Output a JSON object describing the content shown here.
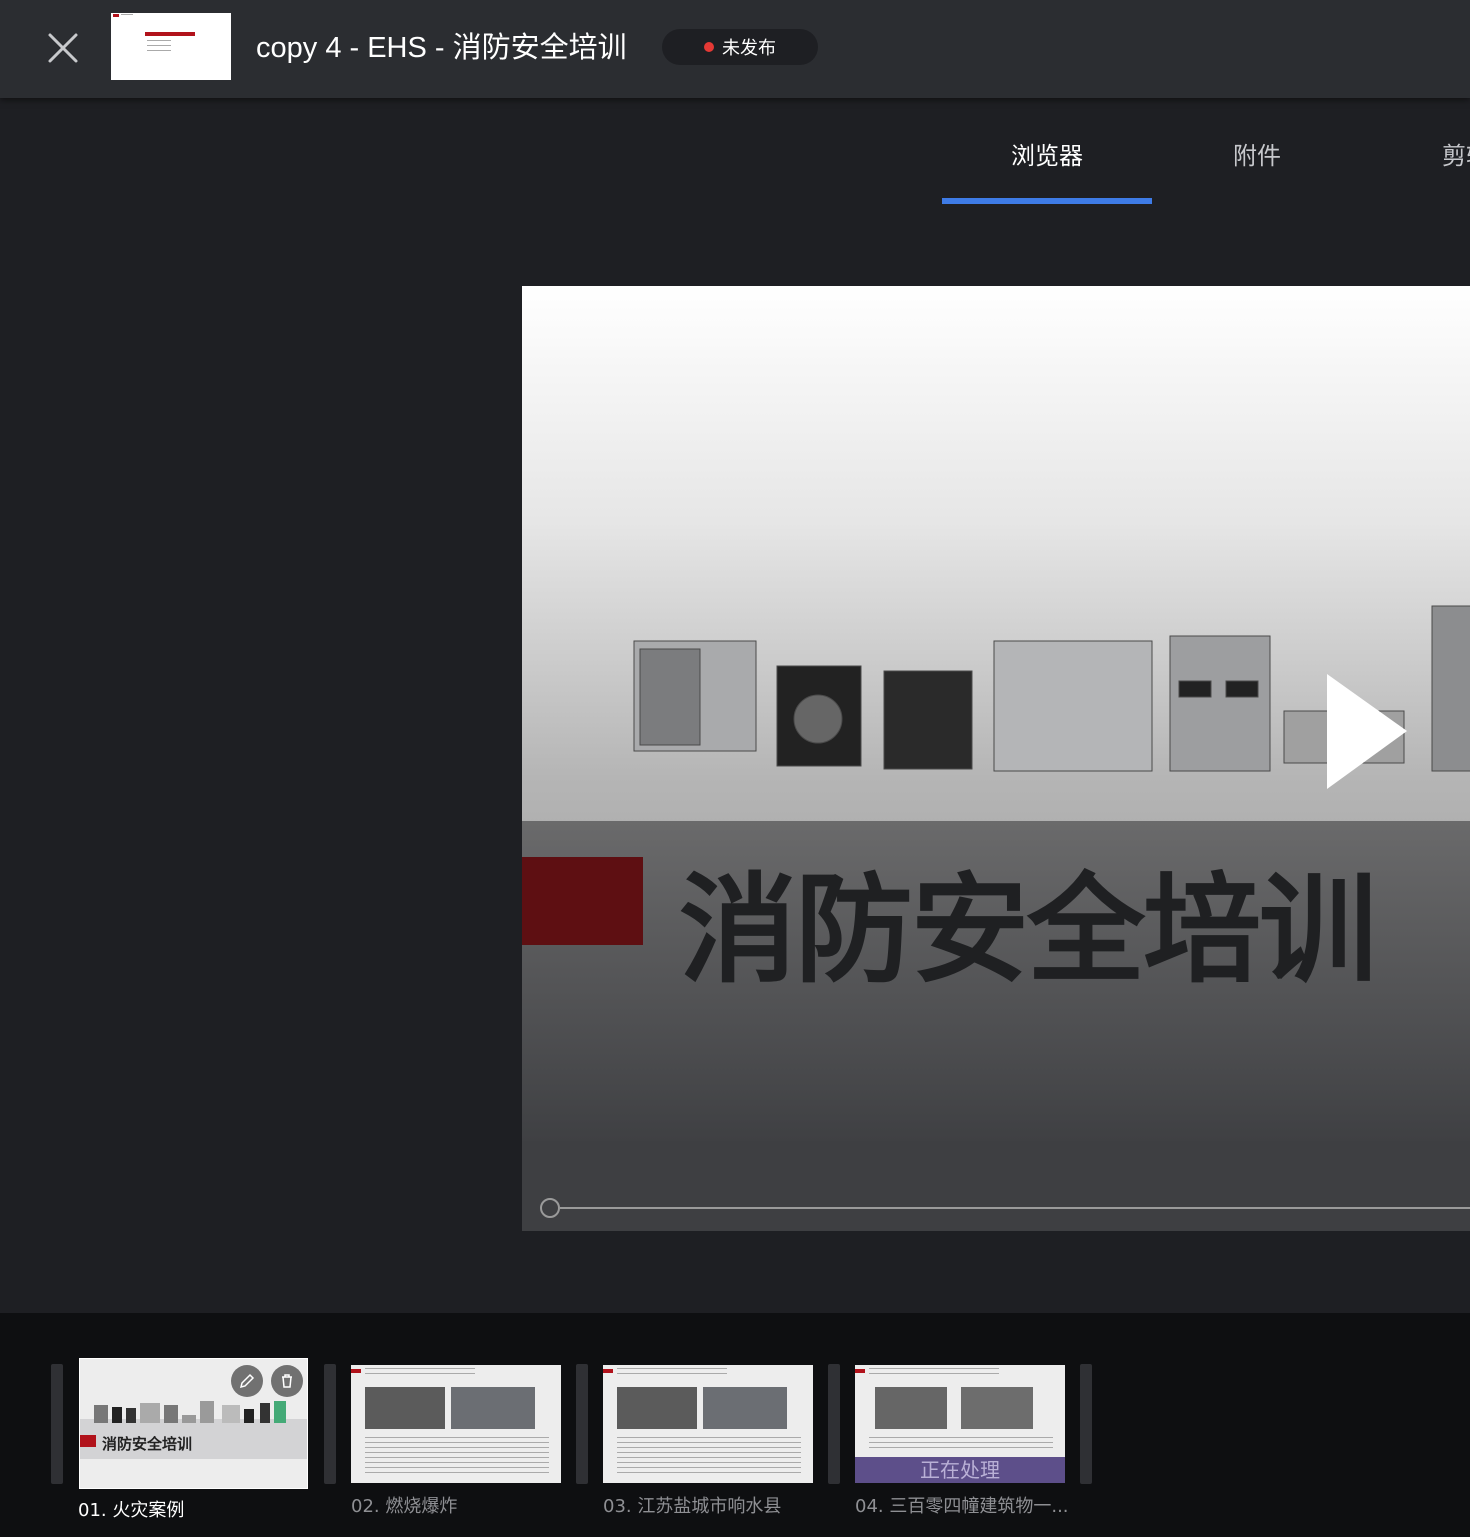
{
  "header": {
    "title": "copy 4 - EHS - 消防安全培训",
    "status": "未发布",
    "status_color": "#e53935"
  },
  "tabs": [
    {
      "label": "浏览器",
      "active": true
    },
    {
      "label": "附件",
      "active": false
    },
    {
      "label": "剪辑",
      "active": false
    }
  ],
  "video": {
    "slide_title": "消防安全培训",
    "accent_color": "#5e0f12"
  },
  "thumbnails": [
    {
      "label": "01. 火灾案例",
      "active": true,
      "cover_title": "消防安全培训"
    },
    {
      "label": "02. 燃烧爆炸",
      "active": false
    },
    {
      "label": "03. 江苏盐城市响水县",
      "active": false
    },
    {
      "label": "04. 三百零四幢建筑物一...",
      "active": false,
      "overlay": "正在处理"
    }
  ],
  "colors": {
    "header_bg": "#2b2d31",
    "page_bg": "#1e1f23",
    "tab_indicator": "#3e7be6",
    "processing_overlay": "#5d4f8a"
  }
}
